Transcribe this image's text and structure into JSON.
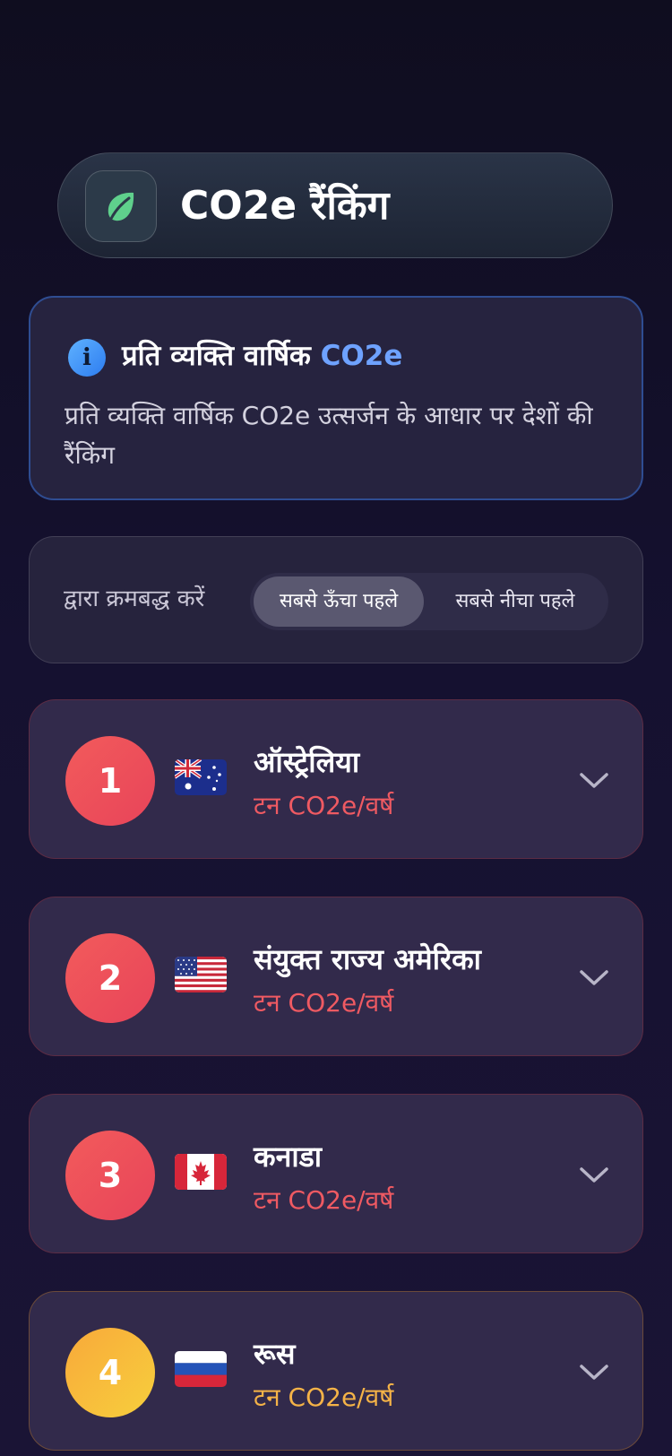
{
  "colors": {
    "background": "#151130",
    "accent_blue": "#6ea2ff",
    "rank_red": "#e8445a",
    "rank_gold": "#f7b93d",
    "unit_red": "#ef5a62",
    "unit_orange": "#f5b347"
  },
  "header": {
    "logo_icon": "leaf-icon",
    "title": "CO2e रैंकिंग"
  },
  "info": {
    "icon": "info-icon",
    "title_part1": "प्रति व्यक्ति वार्षिक",
    "title_part2": "CO2e",
    "description": "प्रति व्यक्ति वार्षिक CO2e उत्सर्जन के आधार पर देशों की रैंकिंग"
  },
  "sort": {
    "label": "द्वारा क्रमबद्ध करें",
    "options": [
      {
        "label": "सबसे ऊँचा पहले",
        "selected": true
      },
      {
        "label": "सबसे नीचा पहले",
        "selected": false
      }
    ]
  },
  "rankings": [
    {
      "rank": "1",
      "flag": "australia-flag",
      "name": "ऑस्ट्रेलिया",
      "unit": "टन CO2e/वर्ष"
    },
    {
      "rank": "2",
      "flag": "usa-flag",
      "name": "संयुक्त राज्य अमेरिका",
      "unit": "टन CO2e/वर्ष"
    },
    {
      "rank": "3",
      "flag": "canada-flag",
      "name": "कनाडा",
      "unit": "टन CO2e/वर्ष"
    },
    {
      "rank": "4",
      "flag": "russia-flag",
      "name": "रूस",
      "unit": "टन CO2e/वर्ष"
    }
  ]
}
